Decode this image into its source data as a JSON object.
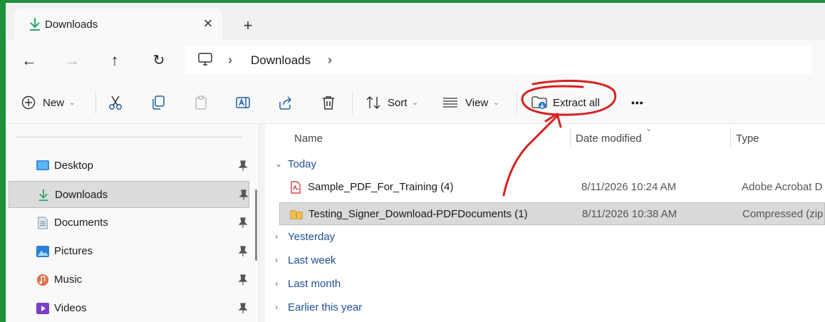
{
  "window": {
    "tab_title": "Downloads",
    "tab_close": "×",
    "new_tab": "+"
  },
  "nav": {
    "back": "←",
    "forward": "→",
    "up": "↑",
    "refresh": "↻"
  },
  "address": {
    "chevron": "›",
    "crumb": "Downloads",
    "trailing_chevron": "›"
  },
  "toolbar": {
    "new_label": "New",
    "sort_label": "Sort",
    "view_label": "View",
    "extract_label": "Extract all",
    "more_label": "•••",
    "caret": "⌄"
  },
  "sidebar": {
    "items": [
      {
        "label": "Desktop",
        "icon": "desktop-icon"
      },
      {
        "label": "Downloads",
        "icon": "download-icon"
      },
      {
        "label": "Documents",
        "icon": "document-icon"
      },
      {
        "label": "Pictures",
        "icon": "pictures-icon"
      },
      {
        "label": "Music",
        "icon": "music-icon"
      },
      {
        "label": "Videos",
        "icon": "videos-icon"
      }
    ]
  },
  "columns": {
    "name": "Name",
    "date": "Date modified",
    "type": "Type"
  },
  "groups": {
    "today": "Today",
    "yesterday": "Yesterday",
    "last_week": "Last week",
    "last_month": "Last month",
    "earlier": "Earlier this year"
  },
  "files": [
    {
      "name": "Sample_PDF_For_Training (4)",
      "date": "8/11/2026 10:24 AM",
      "type": "Adobe Acrobat D",
      "icon": "pdf-icon"
    },
    {
      "name": "Testing_Signer_Download-PDFDocuments (1)",
      "date": "8/11/2026 10:38 AM",
      "type": "Compressed (zip",
      "icon": "zip-folder-icon"
    }
  ],
  "colors": {
    "accent_green": "#1f8f3a",
    "group_blue": "#1f4f96",
    "annotation_red": "#d42222"
  }
}
